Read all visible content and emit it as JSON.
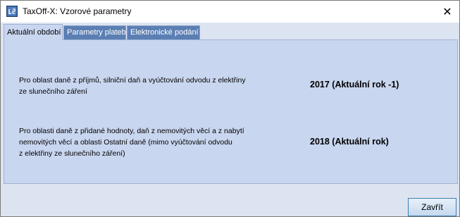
{
  "window": {
    "title": "TaxOff-X: Vzorové parametry",
    "close_glyph": "✕"
  },
  "tabs": [
    {
      "label": "Aktuální období",
      "active": true
    },
    {
      "label": "Parametry plateb",
      "active": false
    },
    {
      "label": "Elektronické podání",
      "active": false
    }
  ],
  "panel": {
    "rows": [
      {
        "label_lines": [
          "Pro oblast daně z příjmů, silniční daň a vyúčtování odvodu z elektřiny",
          "ze slunečního záření"
        ],
        "value": "2017 (Aktuální rok -1)"
      },
      {
        "label_lines": [
          "Pro oblasti daně z přidané hodnoty, daň z nemovitých věcí a z nabytí",
          "nemovitých věcí a oblasti Ostatní daně (mimo vyúčtování odvodu",
          "z elektřiny ze slunečního záření)"
        ],
        "value": "2018 (Aktuální rok)"
      }
    ]
  },
  "footer": {
    "close_label": "Zavřít"
  }
}
